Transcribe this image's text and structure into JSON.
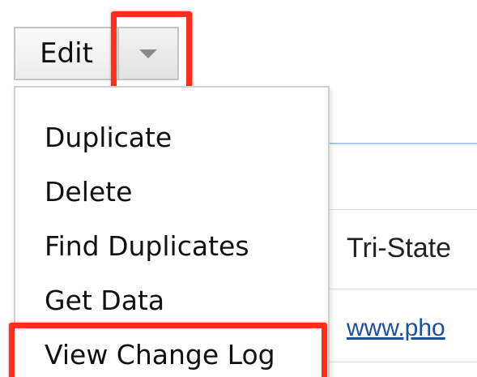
{
  "toolbar": {
    "edit_label": "Edit",
    "dropdown_icon": "caret-down-icon"
  },
  "menu": {
    "items": [
      {
        "label": "Duplicate"
      },
      {
        "label": "Delete"
      },
      {
        "label": "Find Duplicates"
      },
      {
        "label": "Get Data"
      },
      {
        "label": "View Change Log"
      }
    ]
  },
  "background": {
    "account_name": "Tri-State",
    "website": "www.pho"
  },
  "colors": {
    "highlight": "#ff2d1a",
    "link": "#1c4f9c",
    "section_rule": "#a9c9e6"
  }
}
